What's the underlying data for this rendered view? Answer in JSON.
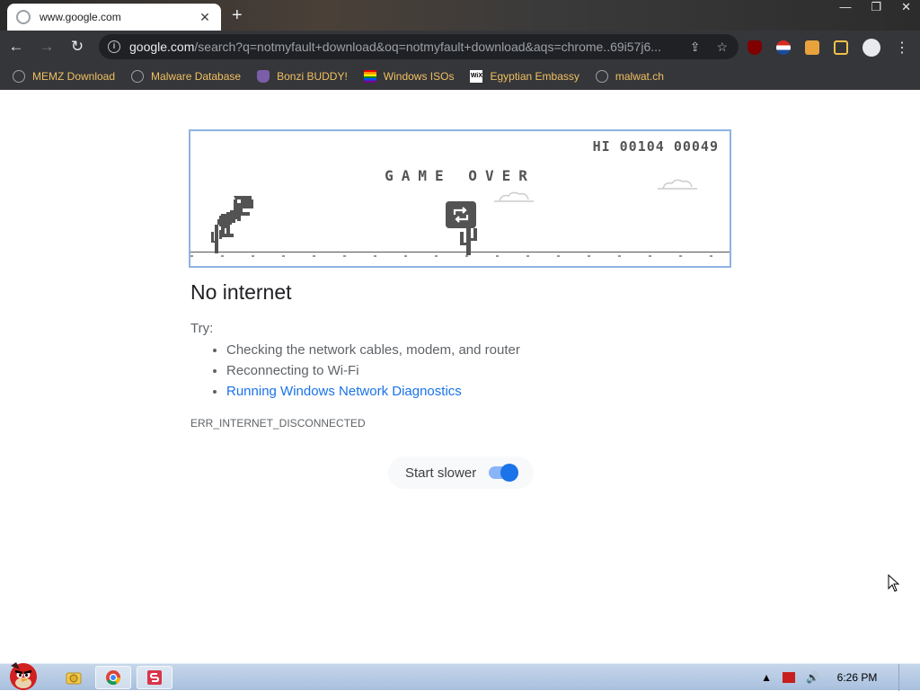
{
  "tab": {
    "title": "www.google.com",
    "close_glyph": "✕"
  },
  "window_controls": {
    "minimize": "—",
    "maximize": "❐",
    "close": "✕"
  },
  "newtab_glyph": "+",
  "toolbar": {
    "back_glyph": "←",
    "forward_glyph": "→",
    "reload_glyph": "↻",
    "url_host": "google.com",
    "url_rest": "/search?q=notmyfault+download&oq=notmyfault+download&aqs=chrome..69i57j6...",
    "share_glyph": "⇪",
    "star_glyph": "☆",
    "menu_glyph": "⋮",
    "info_glyph": "i"
  },
  "bookmarks": [
    {
      "label": "MEMZ Download",
      "icon": "globe-icon"
    },
    {
      "label": "Malware Database",
      "icon": "globe-icon"
    },
    {
      "label": "Bonzi BUDDY!",
      "icon": "bonzi-icon"
    },
    {
      "label": "Windows ISOs",
      "icon": "rainbow-flag-icon"
    },
    {
      "label": "Egyptian Embassy",
      "icon": "wix-icon"
    },
    {
      "label": "malwat.ch",
      "icon": "globe-icon"
    }
  ],
  "wix_text": "WiX",
  "game": {
    "hiscore": "HI 00104 00049",
    "gameover": "GAME OVER"
  },
  "error": {
    "title": "No internet",
    "try_label": "Try:",
    "suggestions": [
      "Checking the network cables, modem, and router",
      "Reconnecting to Wi-Fi"
    ],
    "diagnostics_link": "Running Windows Network Diagnostics",
    "code": "ERR_INTERNET_DISCONNECTED",
    "toggle_label": "Start slower",
    "toggle_on": true
  },
  "taskbar": {
    "clock": "6:26 PM",
    "tray_up_glyph": "▲",
    "volume_glyph": "🔊"
  },
  "colors": {
    "link": "#1a73e8",
    "bookmark_text": "#f0c060",
    "toggle_accent": "#1a73e8"
  }
}
